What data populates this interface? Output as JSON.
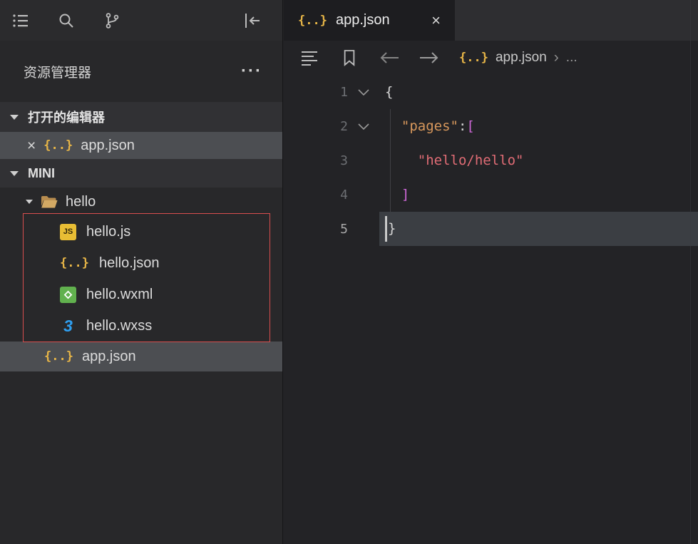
{
  "icons": {
    "more": "···",
    "close": "×",
    "json_badge": "{..}",
    "js_badge": "JS",
    "wxss_badge": "3",
    "breadcrumb_separator": "›",
    "breadcrumb_ellipsis": "..."
  },
  "sidebar": {
    "title": "资源管理器",
    "open_editors": {
      "label": "打开的编辑器",
      "item": "app.json"
    },
    "project": {
      "label": "MINI"
    },
    "tree": {
      "folder": "hello",
      "files": [
        {
          "label": "hello.js",
          "icon": "js-file-icon"
        },
        {
          "label": "hello.json",
          "icon": "json-file-icon"
        },
        {
          "label": "hello.wxml",
          "icon": "wxml-file-icon"
        },
        {
          "label": "hello.wxss",
          "icon": "wxss-file-icon"
        }
      ],
      "root_file": "app.json"
    }
  },
  "editor": {
    "tab": {
      "label": "app.json"
    },
    "breadcrumb": {
      "file": "app.json"
    },
    "code": {
      "language": "json",
      "lines": [
        {
          "num": "1",
          "foldable": true,
          "tokens": [
            {
              "text": "{",
              "type": "punct"
            }
          ]
        },
        {
          "num": "2",
          "foldable": true,
          "tokens": [
            {
              "text": "  ",
              "type": "ws"
            },
            {
              "text": "\"pages\"",
              "type": "key"
            },
            {
              "text": ":",
              "type": "punct"
            },
            {
              "text": "[",
              "type": "bracket"
            }
          ]
        },
        {
          "num": "3",
          "foldable": false,
          "tokens": [
            {
              "text": "    ",
              "type": "ws"
            },
            {
              "text": "\"hello/hello\"",
              "type": "string"
            }
          ]
        },
        {
          "num": "4",
          "foldable": false,
          "tokens": [
            {
              "text": "  ",
              "type": "ws"
            },
            {
              "text": "]",
              "type": "bracket"
            }
          ]
        },
        {
          "num": "5",
          "foldable": false,
          "current_line": true,
          "tokens": [
            {
              "text": "}",
              "type": "punct"
            }
          ]
        }
      ]
    }
  },
  "colors": {
    "key": "#d8985c",
    "string": "#e06c75",
    "bracket": "#cf68d9",
    "punctuation": "#d6d6d6",
    "json_icon": "#e8b647",
    "js_icon_bg": "#e8bd34",
    "wxml_icon": "#61b14e",
    "wxss_icon": "#2f9ff0",
    "folder_icon": "#d3a964",
    "annotation_border": "#d94f4f",
    "selection_bg": "#4c4e52",
    "current_line_bg": "#3b3e43"
  }
}
